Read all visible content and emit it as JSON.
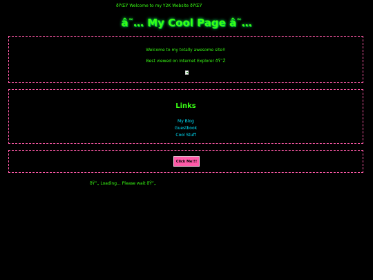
{
  "header": {
    "marquee": "ðŸŒŸ Welcome to my Y2K Website ðŸŒŸ",
    "title": "â˜… My Cool Page â˜…"
  },
  "intro": {
    "welcome": "Welcome to my totally awesome site!!",
    "best_viewed": "Best viewed on Internet Explorer ðŸ˜Ž"
  },
  "links": {
    "heading": "Links",
    "items": [
      "My Blog",
      "Guestbook",
      "Cool Stuff"
    ]
  },
  "action": {
    "button_label": "Click Me!!!"
  },
  "footer": {
    "loading": "ðŸ”„ Loading... Please wait ðŸ”„"
  },
  "colors": {
    "background": "#000000",
    "text": "#39ff14",
    "link": "#00e5ff",
    "border": "#ff5aa8",
    "button": "#ff5aa8"
  }
}
